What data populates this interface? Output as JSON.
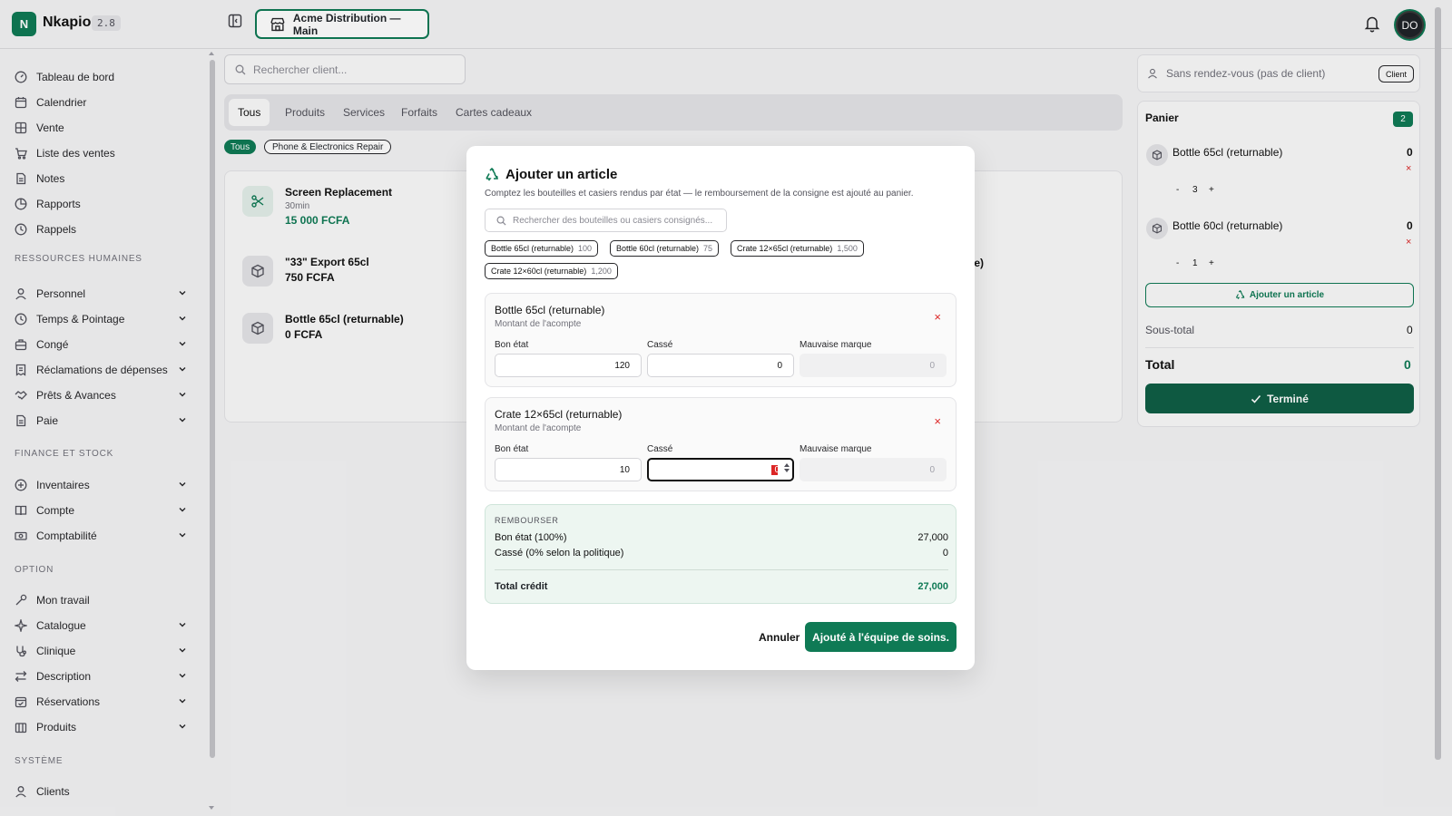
{
  "app": {
    "logo_letter": "N",
    "name": "Nkapio",
    "version": "2.8",
    "branch": "Acme Distribution — Main",
    "user_initials": "DO",
    "accent_color": "#0f7a55"
  },
  "sidebar": {
    "top_items": [
      {
        "label": "Tableau de bord",
        "icon": "dashboard-icon"
      },
      {
        "label": "Calendrier",
        "icon": "calendar-icon"
      },
      {
        "label": "Vente",
        "icon": "grid-icon"
      },
      {
        "label": "Liste des ventes",
        "icon": "cart-icon"
      },
      {
        "label": "Notes",
        "icon": "note-icon"
      },
      {
        "label": "Rapports",
        "icon": "chart-icon"
      },
      {
        "label": "Rappels",
        "icon": "clock-icon"
      }
    ],
    "sections": [
      {
        "label": "RESSOURCES HUMAINES",
        "items": [
          "Personnel",
          "Temps & Pointage",
          "Congé",
          "Réclamations de dépenses",
          "Prêts & Avances",
          "Paie"
        ]
      },
      {
        "label": "FINANCE ET STOCK",
        "items": [
          "Inventaires",
          "Compte",
          "Comptabilité"
        ]
      },
      {
        "label": "OPTION",
        "items": [
          "Mon travail",
          "Catalogue",
          "Clinique",
          "Description",
          "Réservations",
          "Produits"
        ]
      },
      {
        "label": "SYSTÈME",
        "items": [
          "Clients"
        ]
      }
    ]
  },
  "main": {
    "search_placeholder": "Rechercher client...",
    "tabs": [
      "Tous",
      "Produits",
      "Services",
      "Forfaits",
      "Cartes cadeaux"
    ],
    "filter_active": "Tous",
    "filter_category": "Phone & Electronics Repair",
    "products": [
      {
        "name": "Screen Replacement",
        "sub": "30min",
        "price": "15 000 FCFA",
        "icon": "scissors-icon"
      },
      {
        "name": "\"33\" Export 65cl",
        "sub": "",
        "price": "750 FCFA",
        "icon": "box-icon"
      },
      {
        "name": "Bottle 65cl (returnable)",
        "sub": "",
        "price": "0 FCFA",
        "icon": "box-icon"
      }
    ],
    "partial_text": "le)"
  },
  "cart": {
    "walkin_label": "Sans rendez-vous (pas de client)",
    "client_button": "Client",
    "title": "Panier",
    "count": "2",
    "items": [
      {
        "name": "Bottle 65cl (returnable)",
        "value": "0",
        "qty": "3",
        "minus": "-",
        "plus": "+",
        "remove": "×"
      },
      {
        "name": "Bottle 60cl (returnable)",
        "value": "0",
        "qty": "1",
        "minus": "-",
        "plus": "+",
        "remove": "×"
      }
    ],
    "add_item_label": "Ajouter un article",
    "subtotal_label": "Sous-total",
    "subtotal_value": "0",
    "total_label": "Total",
    "total_value": "0",
    "done_label": "Terminé"
  },
  "modal": {
    "title": "Ajouter un article",
    "description": "Comptez les bouteilles et casiers rendus par état — le remboursement de la consigne est ajouté au panier.",
    "search_placeholder": "Rechercher des bouteilles ou casiers consignés...",
    "chips": [
      {
        "label": "Bottle 65cl (returnable)",
        "count": "100"
      },
      {
        "label": "Bottle 60cl (returnable)",
        "count": "75"
      },
      {
        "label": "Crate 12×65cl (returnable)",
        "count": "1,500"
      },
      {
        "label": "Crate 12×60cl (returnable)",
        "count": "1,200"
      }
    ],
    "items": [
      {
        "name": "Bottle 65cl (returnable)",
        "sub": "Montant de l'acompte",
        "remove": "×",
        "labels": [
          "Bon état",
          "Cassé",
          "Mauvaise marque"
        ],
        "values": [
          "120",
          "0",
          "0"
        ]
      },
      {
        "name": "Crate 12×65cl (returnable)",
        "sub": "Montant de l'acompte",
        "remove": "×",
        "labels": [
          "Bon état",
          "Cassé",
          "Mauvaise marque"
        ],
        "values": [
          "10",
          "0",
          "0"
        ]
      }
    ],
    "refund": {
      "heading": "REMBOURSER",
      "rows": [
        {
          "label": "Bon état (100%)",
          "value": "27,000"
        },
        {
          "label": "Cassé (0% selon la politique)",
          "value": "0"
        }
      ],
      "total_label": "Total crédit",
      "total_value": "27,000"
    },
    "cancel_label": "Annuler",
    "confirm_label": "Ajouté à l'équipe de soins."
  }
}
